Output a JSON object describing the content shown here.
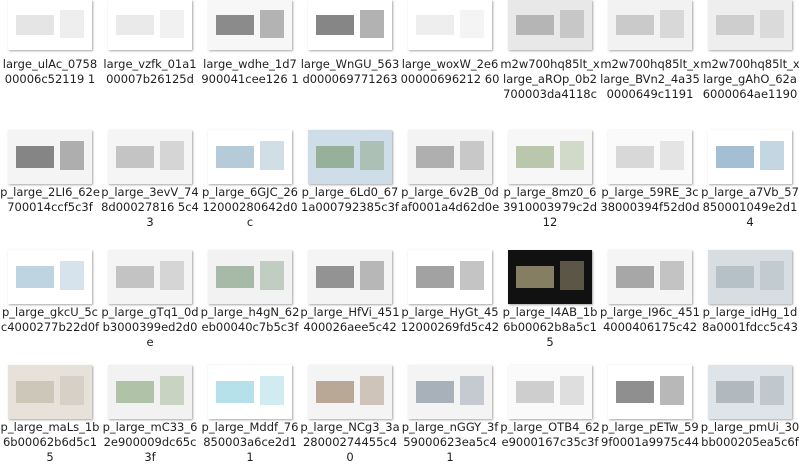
{
  "files": [
    {
      "name": "large_ulAc_075800006c52119 1",
      "bg": "#ffffff",
      "accent": "#cfcfcf"
    },
    {
      "name": "large_vzfk_01a100007b26125d",
      "bg": "#ffffff",
      "accent": "#d8d8d8"
    },
    {
      "name": "large_wdhe_1d7900041cee126 1",
      "bg": "#f7f7f7",
      "accent": "#333333"
    },
    {
      "name": "large_WnGU_563d000069771263",
      "bg": "#ffffff",
      "accent": "#222222"
    },
    {
      "name": "large_woxW_2e600000696212 60",
      "bg": "#ffffff",
      "accent": "#e0e0e0"
    },
    {
      "name": "m2w700hq85lt_xlarge_aROp_0b2700003da4118c",
      "bg": "#e8e8e8",
      "accent": "#8a8a8a"
    },
    {
      "name": "m2w700hq85lt_xlarge_BVn2_4a350000649c1191",
      "bg": "#f2f2f2",
      "accent": "#a9a9a9"
    },
    {
      "name": "m2w700hq85lt_xlarge_gAhO_62a6000064ae1190",
      "bg": "#eeeeee",
      "accent": "#b5b5b5"
    },
    {
      "name": "p_large_2LI6_62e700014ccf5c3f",
      "bg": "#f4f4f4",
      "accent": "#2a2a2a"
    },
    {
      "name": "p_large_3evV_748d00027816 5c43",
      "bg": "#f5f5f5",
      "accent": "#9a9a9a"
    },
    {
      "name": "p_large_6GJC_2612000280642d0c",
      "bg": "#ffffff",
      "accent": "#7aa0b8"
    },
    {
      "name": "p_large_6Ld0_671a000792385c3f",
      "bg": "#cfdde8",
      "accent": "#6a8a5a"
    },
    {
      "name": "p_large_6v2B_0daf0001a4d62d0e",
      "bg": "#f3f3f3",
      "accent": "#777777"
    },
    {
      "name": "p_large_8mz0_63910003979c2d12",
      "bg": "#f7f7f7",
      "accent": "#8aa070"
    },
    {
      "name": "p_large_59RE_3c38000394f52d0d",
      "bg": "#fafafa",
      "accent": "#bbbbbb"
    },
    {
      "name": "p_large_a7Vb_57850001049e2d14",
      "bg": "#ffffff",
      "accent": "#5a8ab0"
    },
    {
      "name": "p_large_gkcU_5cc4000277b22d0f",
      "bg": "#ffffff",
      "accent": "#8ab0c8"
    },
    {
      "name": "p_large_gTq1_0db3000399ed2d0e",
      "bg": "#f4f4f4",
      "accent": "#9a9a9a"
    },
    {
      "name": "p_large_h4gN_62eb00040c7b5c3f",
      "bg": "#f2f2f2",
      "accent": "#6a8a6a"
    },
    {
      "name": "p_large_HfVi_451400026aee5c42",
      "bg": "#f4f4f4",
      "accent": "#444444"
    },
    {
      "name": "p_large_HyGt_4512000269fd5c42",
      "bg": "#ffffff",
      "accent": "#555555"
    },
    {
      "name": "p_large_I4AB_1b6b00062b8a5c15",
      "bg": "#111111",
      "accent": "#e8d8a8"
    },
    {
      "name": "p_large_I96c_4514000406175c42",
      "bg": "#f5f5f5",
      "accent": "#666666"
    },
    {
      "name": "p_large_idHg_1d8a0001fdcc5c43",
      "bg": "#d8dde2",
      "accent": "#9aa8b0"
    },
    {
      "name": "p_large_maLs_1b6b00062b6d5c15",
      "bg": "#e6e2da",
      "accent": "#b8b0a0"
    },
    {
      "name": "p_large_mC33_62e900009dc65c3f",
      "bg": "#f2f2f2",
      "accent": "#7a9a6a"
    },
    {
      "name": "p_large_Mddf_76850003a6ce2d11",
      "bg": "#ffffff",
      "accent": "#7ac8d8"
    },
    {
      "name": "p_large_NCg3_3a28000274455c40",
      "bg": "#f4f4f4",
      "accent": "#8a6a4a"
    },
    {
      "name": "p_large_nGGY_3f59000623ea5c41",
      "bg": "#f4f4f4",
      "accent": "#6a7a8a"
    },
    {
      "name": "p_large_OTB4_62e9000167c35c3f",
      "bg": "#fafafa",
      "accent": "#aaaaaa"
    },
    {
      "name": "p_large_pETw_599f0001a9975c44",
      "bg": "#ffffff",
      "accent": "#333333"
    },
    {
      "name": "p_large_pmUi_30bb000205ea5c6f",
      "bg": "#dfe4e8",
      "accent": "#8a949a"
    }
  ],
  "theme": {
    "page_bg": "#ffffff",
    "text": "#1e1e1e"
  }
}
